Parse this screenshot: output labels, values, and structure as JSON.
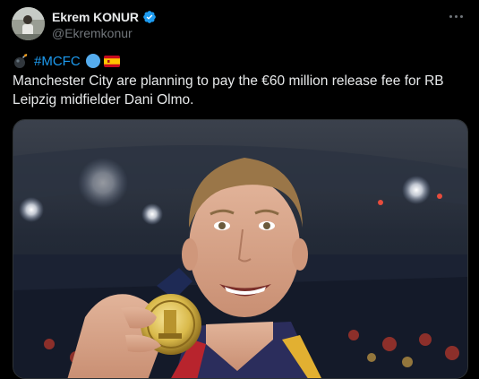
{
  "author": {
    "display_name": "Ekrem KONUR",
    "handle": "@Ekremkonur",
    "verified": true
  },
  "tweet": {
    "hashtag": "#MCFC",
    "text": "Manchester City are planning to pay the €60 million release fee for RB Leipzig midfielder Dani Olmo."
  },
  "icons": {
    "verified": "verified-badge-icon",
    "more": "more-options-icon",
    "bomb": "bomb-emoji-icon",
    "circle": "blue-circle-emoji-icon",
    "flag": "spain-flag-icon"
  },
  "colors": {
    "background": "#000000",
    "text": "#e7e9ea",
    "secondary": "#71767b",
    "link": "#1d9bf0",
    "verified": "#1d9bf0"
  }
}
